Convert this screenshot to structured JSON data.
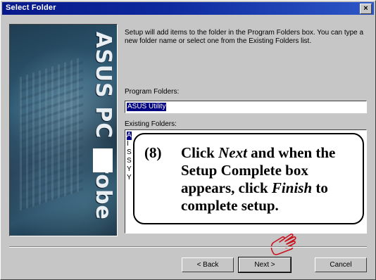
{
  "window": {
    "title": "Select Folder",
    "close_glyph": "×"
  },
  "banner": {
    "vertical_text": "ASUS PC Probe"
  },
  "instructions": "Setup will add items to the folder in the Program Folders box. You can type a new folder name or select one from the Existing Folders list.",
  "program_folders": {
    "label": "Program Folders:",
    "value": "ASUS Utility"
  },
  "existing_folders": {
    "label": "Existing Folders:",
    "items": [
      "A",
      "I",
      "S",
      "S",
      "Y",
      "Y"
    ],
    "selected_index": 0
  },
  "callout": {
    "step": "(8)",
    "line1_pre": "Click ",
    "line1_em": "Next",
    "line1_post": " and when the Setup Complete box appears, click ",
    "line2_em": "Finish",
    "line2_post": " to complete setup."
  },
  "buttons": {
    "back": "< Back",
    "next": "Next >",
    "cancel": "Cancel"
  },
  "icons": {
    "pointer": "pointing-hand-icon",
    "close": "close-icon"
  }
}
